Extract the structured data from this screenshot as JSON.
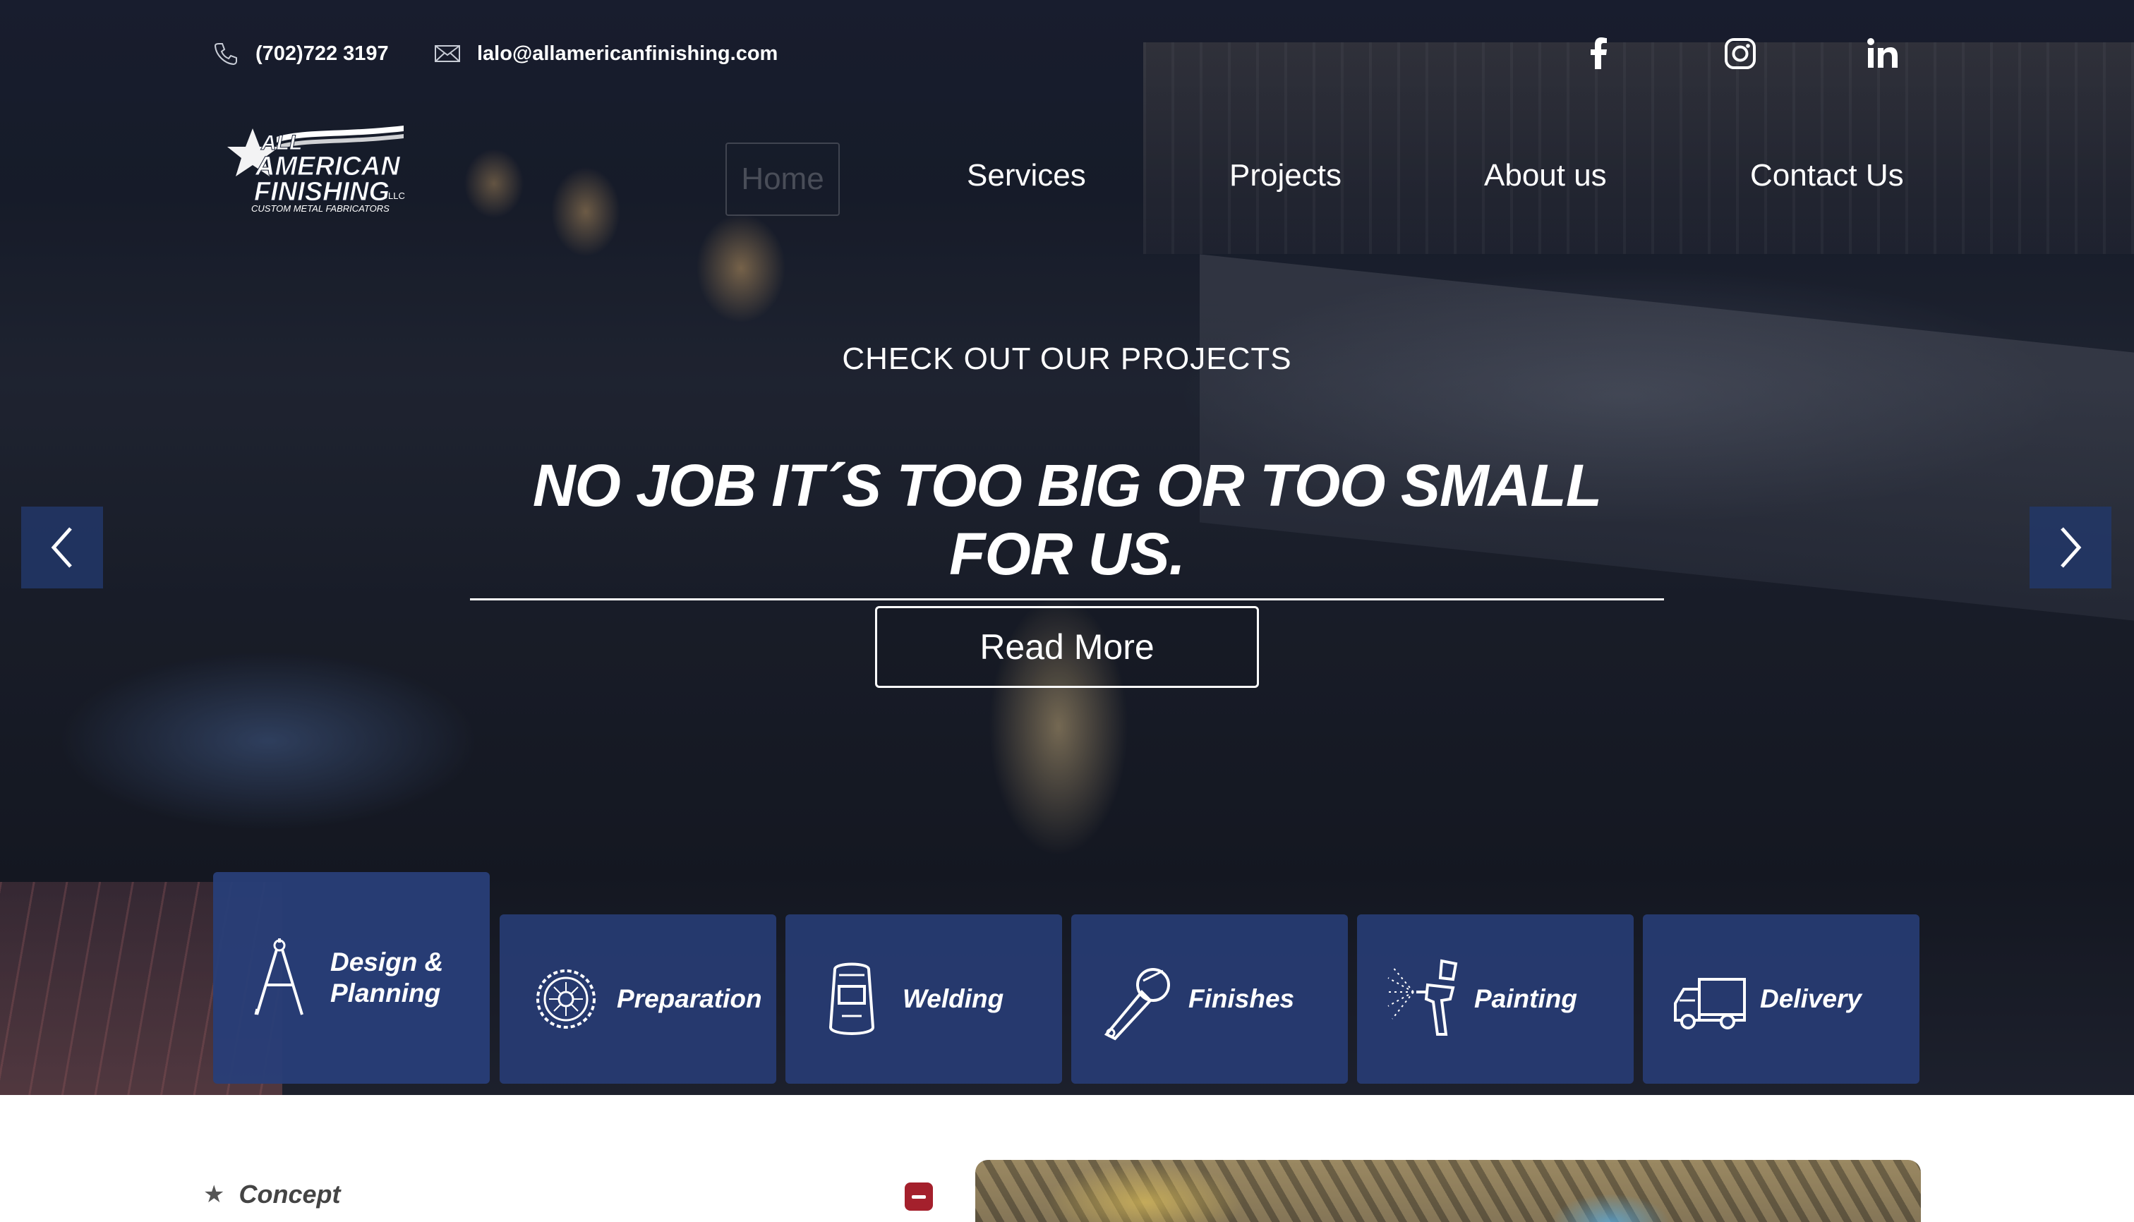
{
  "contact": {
    "phone": "(702)722 3197",
    "email": "lalo@allamericanfinishing.com"
  },
  "social": [
    "facebook-icon",
    "instagram-icon",
    "linkedin-icon"
  ],
  "logo": {
    "line1": "ALL",
    "line2": "AMERICAN",
    "line3": "FINISHING",
    "suffix": "LLC",
    "tagline": "CUSTOM METAL FABRICATORS"
  },
  "nav": {
    "home": "Home",
    "services": "Services",
    "projects": "Projects",
    "about": "About us",
    "contact": "Contact Us"
  },
  "hero": {
    "eyebrow": "CHECK OUT OUR PROJECTS",
    "headline": "NO JOB IT´S TOO BIG OR TOO SMALL FOR US.",
    "cta": "Read More"
  },
  "services": [
    {
      "label": "Design & Planning",
      "icon": "compass-icon",
      "active": true
    },
    {
      "label": "Preparation",
      "icon": "saw-blade-icon",
      "active": false
    },
    {
      "label": "Welding",
      "icon": "welding-mask-icon",
      "active": false
    },
    {
      "label": "Finishes",
      "icon": "angle-grinder-icon",
      "active": false
    },
    {
      "label": "Painting",
      "icon": "spray-gun-icon",
      "active": false
    },
    {
      "label": "Delivery",
      "icon": "truck-icon",
      "active": false
    }
  ],
  "accordion": {
    "label": "Concept",
    "toggle": "collapse"
  },
  "colors": {
    "card_blue": "#283e78",
    "accent_red": "#a4202c"
  }
}
